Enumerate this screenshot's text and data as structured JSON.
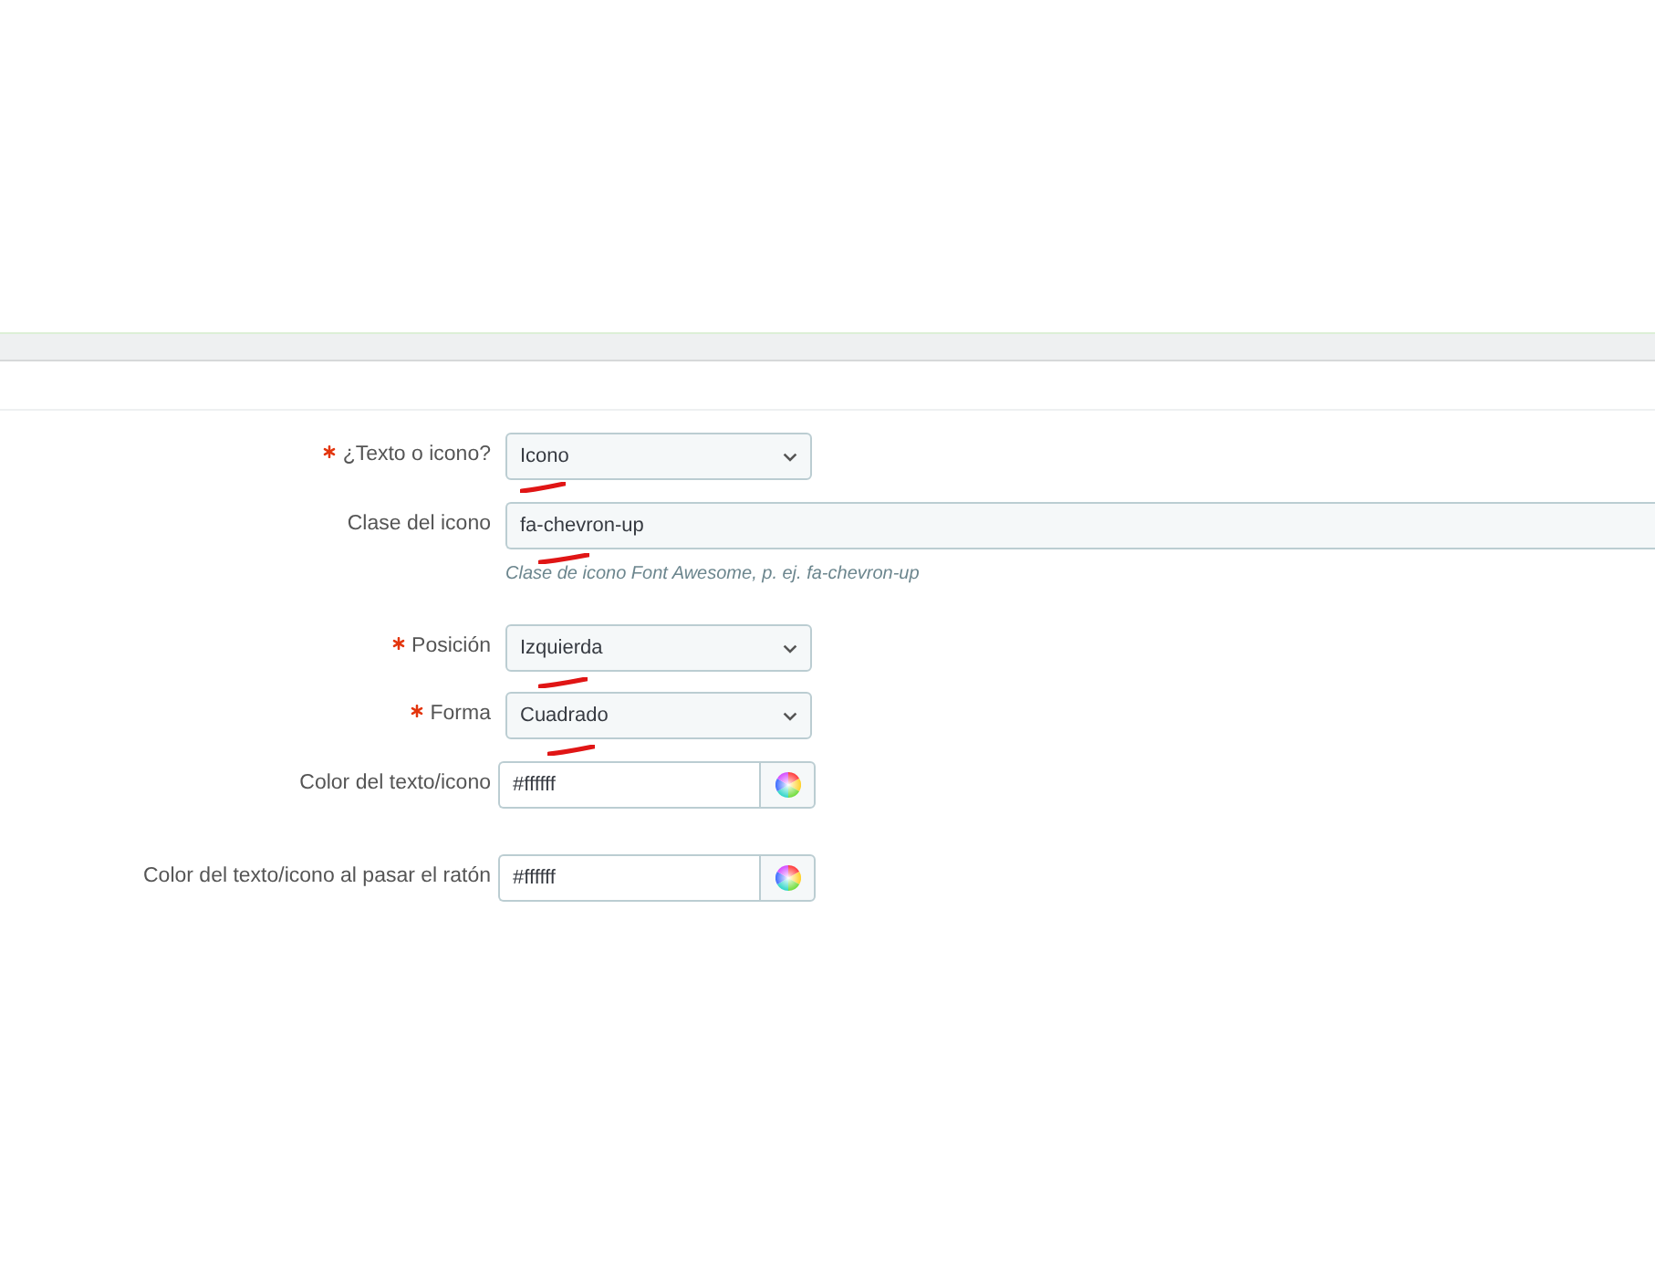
{
  "form": {
    "fields": [
      {
        "kind": "select",
        "label": "¿Texto o icono?",
        "required": true,
        "value": "Icono",
        "marked": true
      },
      {
        "kind": "text",
        "label": "Clase del icono",
        "required": false,
        "value": "fa-chevron-up",
        "help": "Clase de icono Font Awesome, p. ej. fa-chevron-up",
        "marked": true
      },
      {
        "kind": "select",
        "label": "Posición",
        "required": true,
        "value": "Izquierda",
        "marked": true
      },
      {
        "kind": "select",
        "label": "Forma",
        "required": true,
        "value": "Cuadrado",
        "marked": true
      },
      {
        "kind": "color",
        "label": "Color del texto/icono",
        "required": false,
        "value": "#ffffff",
        "marked": false
      },
      {
        "kind": "color",
        "label": "Color del texto/icono al pasar el ratón",
        "required": false,
        "value": "#ffffff",
        "marked": false
      }
    ]
  }
}
